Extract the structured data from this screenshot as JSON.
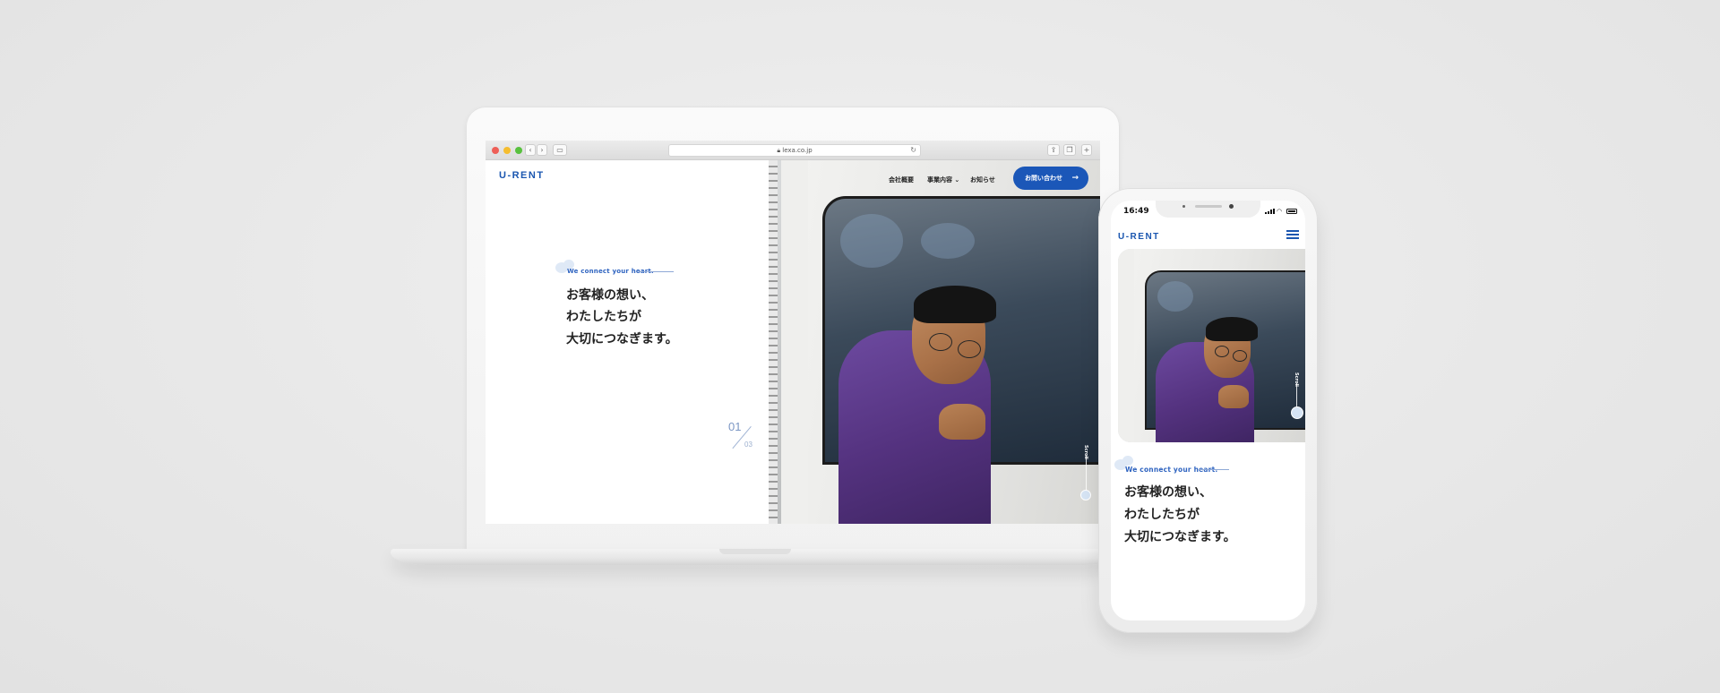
{
  "browser": {
    "url": "lexa.co.jp"
  },
  "site": {
    "logo": "U-RENT",
    "nav": [
      "会社概要",
      "事業内容",
      "お知らせ"
    ],
    "cta_label": "お問い合わせ",
    "cta_arrow": "→",
    "tagline": "We connect your heart.",
    "heading": [
      "お客様の想い、",
      "わたしたちが",
      "大切につなぎます。"
    ],
    "pager_current": "01",
    "pager_total": "03",
    "scroll_label": "Scroll"
  },
  "phone": {
    "time": "16:49"
  },
  "colors": {
    "brand": "#1a56b0",
    "cta": "#1b57b8",
    "background": "#e8e8e8"
  },
  "icons": [
    "back-chevron-icon",
    "forward-chevron-icon",
    "sidebar-icon",
    "lock-icon",
    "reload-icon",
    "share-icon",
    "tabs-icon",
    "new-tab-icon",
    "chevron-down-icon",
    "arrow-right-icon",
    "hamburger-menu-icon",
    "signal-icon",
    "wifi-icon",
    "battery-icon"
  ]
}
